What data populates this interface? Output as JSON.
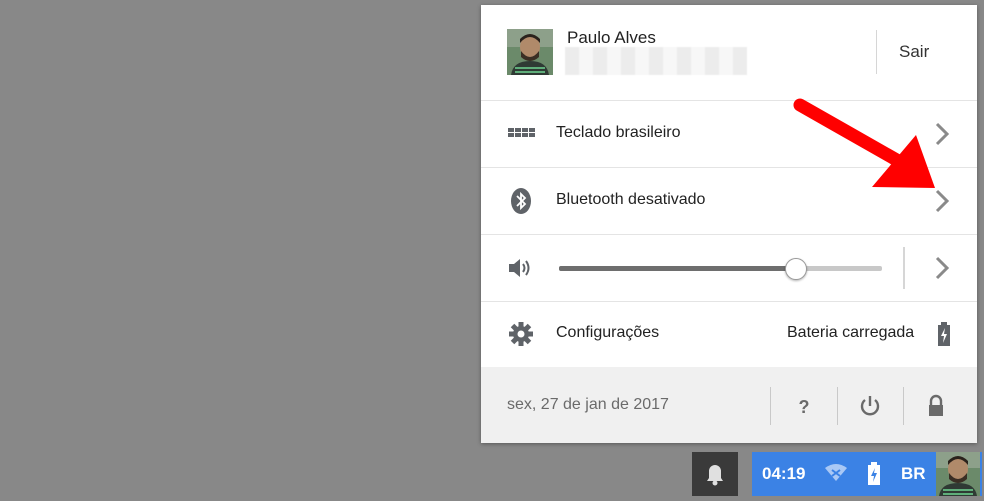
{
  "user": {
    "name": "Paulo Alves",
    "signout_label": "Sair",
    "avatar_icon": "user-avatar"
  },
  "rows": {
    "keyboard": {
      "label": "Teclado brasileiro",
      "icon": "keyboard-icon"
    },
    "bluetooth": {
      "label": "Bluetooth desativado",
      "icon": "bluetooth-icon"
    },
    "volume": {
      "level": 0.73,
      "icon": "speaker-icon"
    },
    "settings": {
      "label": "Configurações",
      "icon": "gear-icon",
      "battery_label": "Bateria carregada"
    }
  },
  "footer": {
    "date": "sex, 27 de jan de 2017",
    "help_icon": "help-icon",
    "power_icon": "power-icon",
    "lock_icon": "lock-icon"
  },
  "tray": {
    "time": "04:19",
    "keyboard_layout": "BR",
    "wifi_icon": "wifi-icon",
    "battery_icon": "battery-charging-icon"
  },
  "annotation": {
    "arrow_color": "#ff0000"
  },
  "colors": {
    "tray_bg": "#3b82e5",
    "panel_bg": "#ffffff",
    "desktop_bg": "#888888"
  }
}
